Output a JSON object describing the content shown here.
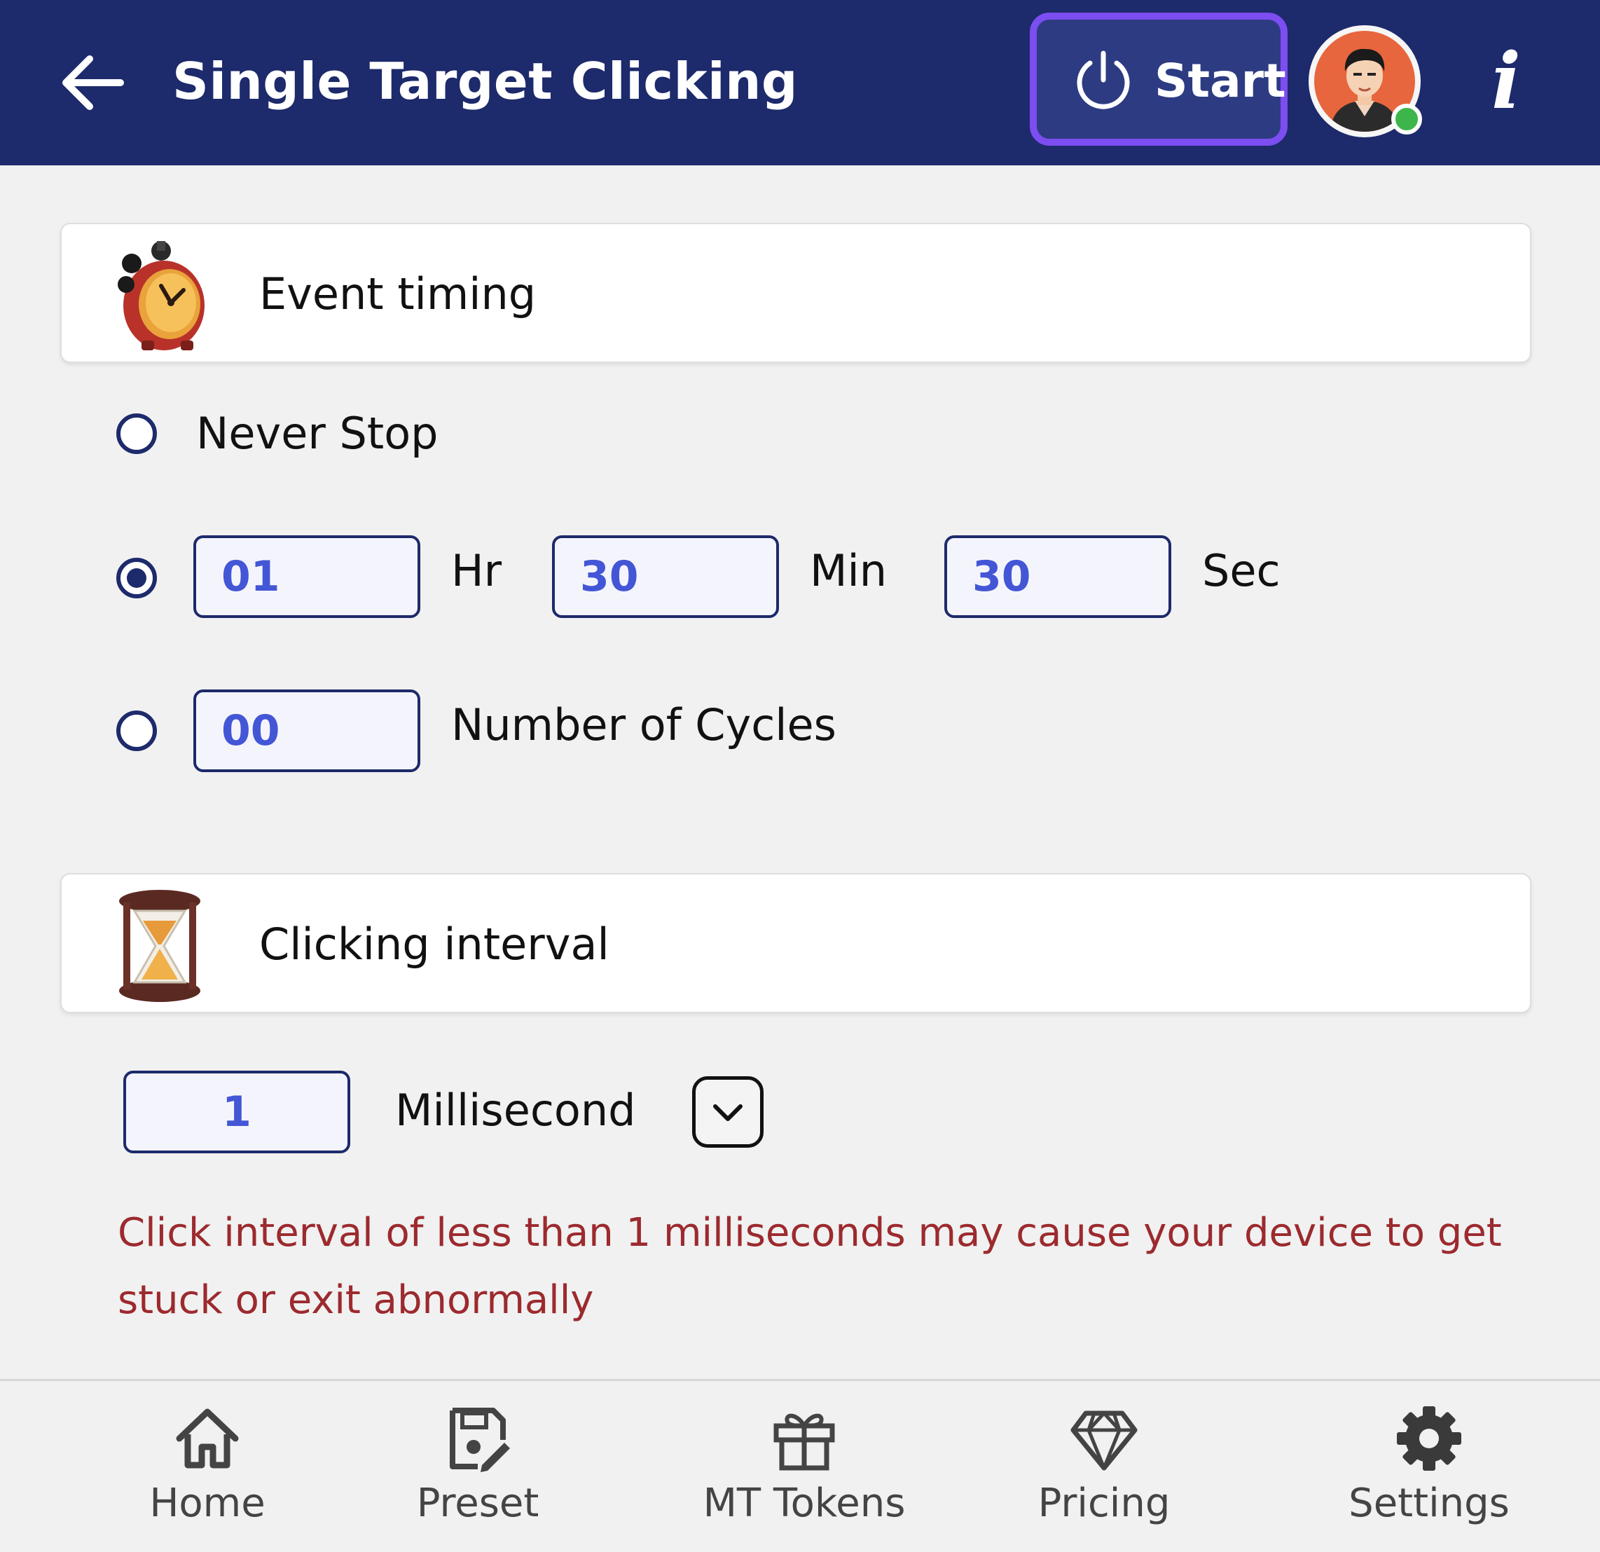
{
  "header": {
    "title": "Single Target Clicking",
    "start_label": "Start",
    "info_label": "i"
  },
  "event_timing": {
    "title": "Event timing",
    "never_stop_label": "Never Stop",
    "duration": {
      "selected": true,
      "hours": "01",
      "hours_label": "Hr",
      "minutes": "30",
      "minutes_label": "Min",
      "seconds": "30",
      "seconds_label": "Sec"
    },
    "cycles": {
      "value": "00",
      "label": "Number of Cycles"
    }
  },
  "clicking_interval": {
    "title": "Clicking interval",
    "value": "1",
    "unit": "Millisecond",
    "warning": "Click interval of  less than 1 milliseconds may cause your device to get stuck or exit abnormally"
  },
  "bottom_nav": {
    "items": [
      {
        "label": "Home",
        "icon": "home-icon"
      },
      {
        "label": "Preset",
        "icon": "preset-icon"
      },
      {
        "label": "MT Tokens",
        "icon": "gift-icon"
      },
      {
        "label": "Pricing",
        "icon": "diamond-icon"
      },
      {
        "label": "Settings",
        "icon": "gear-icon"
      }
    ]
  },
  "colors": {
    "header_bg": "#1d2a6b",
    "start_border": "#7c4df0",
    "input_text": "#4356d6",
    "warning_text": "#9c2a2e",
    "online_status": "#3cb64a"
  }
}
